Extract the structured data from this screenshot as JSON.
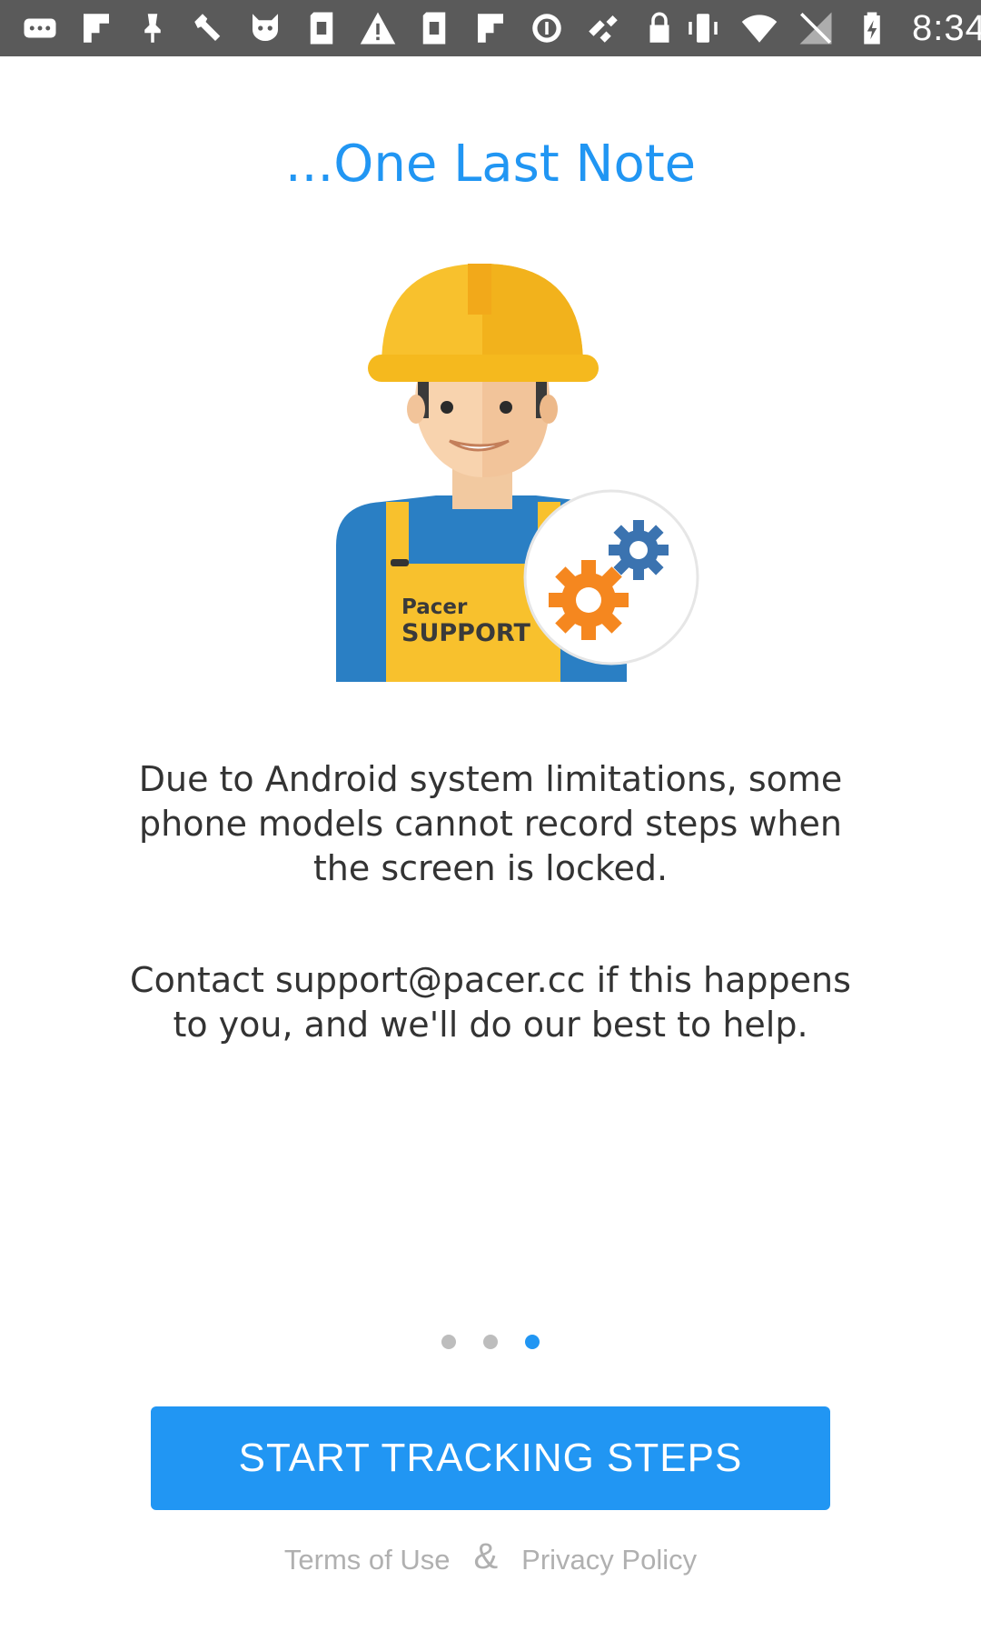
{
  "status_bar": {
    "time": "8:34",
    "left_icons": [
      "messages-icon",
      "flipboard-icon",
      "notification-icon",
      "wrench-icon",
      "cat-icon",
      "sd-card-icon",
      "warning-icon",
      "sd-card-icon",
      "flipboard-icon",
      "circle-notification-icon",
      "fake-gps-icon",
      "lock-icon"
    ],
    "right_icons": [
      "vibrate-icon",
      "wifi-icon",
      "no-signal-icon",
      "battery-charging-icon"
    ]
  },
  "page": {
    "title": "...One Last Note",
    "illustration_badge_line1": "Pacer",
    "illustration_badge_line2": "SUPPORT",
    "message_1": "Due to Android system limitations, some phone models cannot record steps when the screen is locked.",
    "message_2": "Contact support@pacer.cc if this happens to you, and we'll do our best to help."
  },
  "pager": {
    "total": 3,
    "active_index": 2
  },
  "actions": {
    "start_button_label": "START TRACKING STEPS"
  },
  "footer": {
    "terms_label": "Terms of Use",
    "separator": "&",
    "privacy_label": "Privacy Policy"
  },
  "colors": {
    "accent": "#2196F3",
    "status_bar": "#5a5a5a",
    "helmet": "#F8C12D",
    "overall_blue": "#2A7FC4",
    "gear_orange": "#F5871F",
    "gear_blue": "#3B73B0"
  }
}
